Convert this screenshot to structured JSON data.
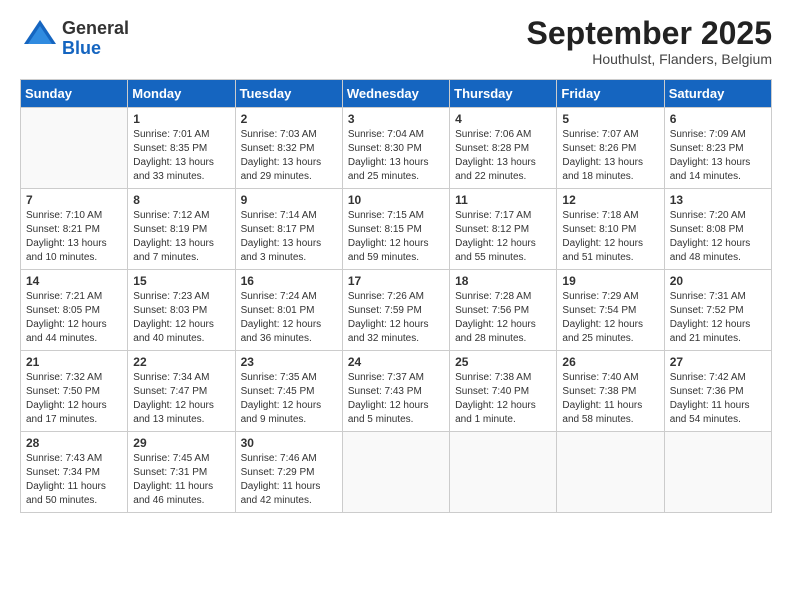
{
  "logo": {
    "general": "General",
    "blue": "Blue"
  },
  "header": {
    "month": "September 2025",
    "location": "Houthulst, Flanders, Belgium"
  },
  "days_of_week": [
    "Sunday",
    "Monday",
    "Tuesday",
    "Wednesday",
    "Thursday",
    "Friday",
    "Saturday"
  ],
  "weeks": [
    [
      {
        "day": "",
        "info": ""
      },
      {
        "day": "1",
        "info": "Sunrise: 7:01 AM\nSunset: 8:35 PM\nDaylight: 13 hours\nand 33 minutes."
      },
      {
        "day": "2",
        "info": "Sunrise: 7:03 AM\nSunset: 8:32 PM\nDaylight: 13 hours\nand 29 minutes."
      },
      {
        "day": "3",
        "info": "Sunrise: 7:04 AM\nSunset: 8:30 PM\nDaylight: 13 hours\nand 25 minutes."
      },
      {
        "day": "4",
        "info": "Sunrise: 7:06 AM\nSunset: 8:28 PM\nDaylight: 13 hours\nand 22 minutes."
      },
      {
        "day": "5",
        "info": "Sunrise: 7:07 AM\nSunset: 8:26 PM\nDaylight: 13 hours\nand 18 minutes."
      },
      {
        "day": "6",
        "info": "Sunrise: 7:09 AM\nSunset: 8:23 PM\nDaylight: 13 hours\nand 14 minutes."
      }
    ],
    [
      {
        "day": "7",
        "info": "Sunrise: 7:10 AM\nSunset: 8:21 PM\nDaylight: 13 hours\nand 10 minutes."
      },
      {
        "day": "8",
        "info": "Sunrise: 7:12 AM\nSunset: 8:19 PM\nDaylight: 13 hours\nand 7 minutes."
      },
      {
        "day": "9",
        "info": "Sunrise: 7:14 AM\nSunset: 8:17 PM\nDaylight: 13 hours\nand 3 minutes."
      },
      {
        "day": "10",
        "info": "Sunrise: 7:15 AM\nSunset: 8:15 PM\nDaylight: 12 hours\nand 59 minutes."
      },
      {
        "day": "11",
        "info": "Sunrise: 7:17 AM\nSunset: 8:12 PM\nDaylight: 12 hours\nand 55 minutes."
      },
      {
        "day": "12",
        "info": "Sunrise: 7:18 AM\nSunset: 8:10 PM\nDaylight: 12 hours\nand 51 minutes."
      },
      {
        "day": "13",
        "info": "Sunrise: 7:20 AM\nSunset: 8:08 PM\nDaylight: 12 hours\nand 48 minutes."
      }
    ],
    [
      {
        "day": "14",
        "info": "Sunrise: 7:21 AM\nSunset: 8:05 PM\nDaylight: 12 hours\nand 44 minutes."
      },
      {
        "day": "15",
        "info": "Sunrise: 7:23 AM\nSunset: 8:03 PM\nDaylight: 12 hours\nand 40 minutes."
      },
      {
        "day": "16",
        "info": "Sunrise: 7:24 AM\nSunset: 8:01 PM\nDaylight: 12 hours\nand 36 minutes."
      },
      {
        "day": "17",
        "info": "Sunrise: 7:26 AM\nSunset: 7:59 PM\nDaylight: 12 hours\nand 32 minutes."
      },
      {
        "day": "18",
        "info": "Sunrise: 7:28 AM\nSunset: 7:56 PM\nDaylight: 12 hours\nand 28 minutes."
      },
      {
        "day": "19",
        "info": "Sunrise: 7:29 AM\nSunset: 7:54 PM\nDaylight: 12 hours\nand 25 minutes."
      },
      {
        "day": "20",
        "info": "Sunrise: 7:31 AM\nSunset: 7:52 PM\nDaylight: 12 hours\nand 21 minutes."
      }
    ],
    [
      {
        "day": "21",
        "info": "Sunrise: 7:32 AM\nSunset: 7:50 PM\nDaylight: 12 hours\nand 17 minutes."
      },
      {
        "day": "22",
        "info": "Sunrise: 7:34 AM\nSunset: 7:47 PM\nDaylight: 12 hours\nand 13 minutes."
      },
      {
        "day": "23",
        "info": "Sunrise: 7:35 AM\nSunset: 7:45 PM\nDaylight: 12 hours\nand 9 minutes."
      },
      {
        "day": "24",
        "info": "Sunrise: 7:37 AM\nSunset: 7:43 PM\nDaylight: 12 hours\nand 5 minutes."
      },
      {
        "day": "25",
        "info": "Sunrise: 7:38 AM\nSunset: 7:40 PM\nDaylight: 12 hours\nand 1 minute."
      },
      {
        "day": "26",
        "info": "Sunrise: 7:40 AM\nSunset: 7:38 PM\nDaylight: 11 hours\nand 58 minutes."
      },
      {
        "day": "27",
        "info": "Sunrise: 7:42 AM\nSunset: 7:36 PM\nDaylight: 11 hours\nand 54 minutes."
      }
    ],
    [
      {
        "day": "28",
        "info": "Sunrise: 7:43 AM\nSunset: 7:34 PM\nDaylight: 11 hours\nand 50 minutes."
      },
      {
        "day": "29",
        "info": "Sunrise: 7:45 AM\nSunset: 7:31 PM\nDaylight: 11 hours\nand 46 minutes."
      },
      {
        "day": "30",
        "info": "Sunrise: 7:46 AM\nSunset: 7:29 PM\nDaylight: 11 hours\nand 42 minutes."
      },
      {
        "day": "",
        "info": ""
      },
      {
        "day": "",
        "info": ""
      },
      {
        "day": "",
        "info": ""
      },
      {
        "day": "",
        "info": ""
      }
    ]
  ]
}
